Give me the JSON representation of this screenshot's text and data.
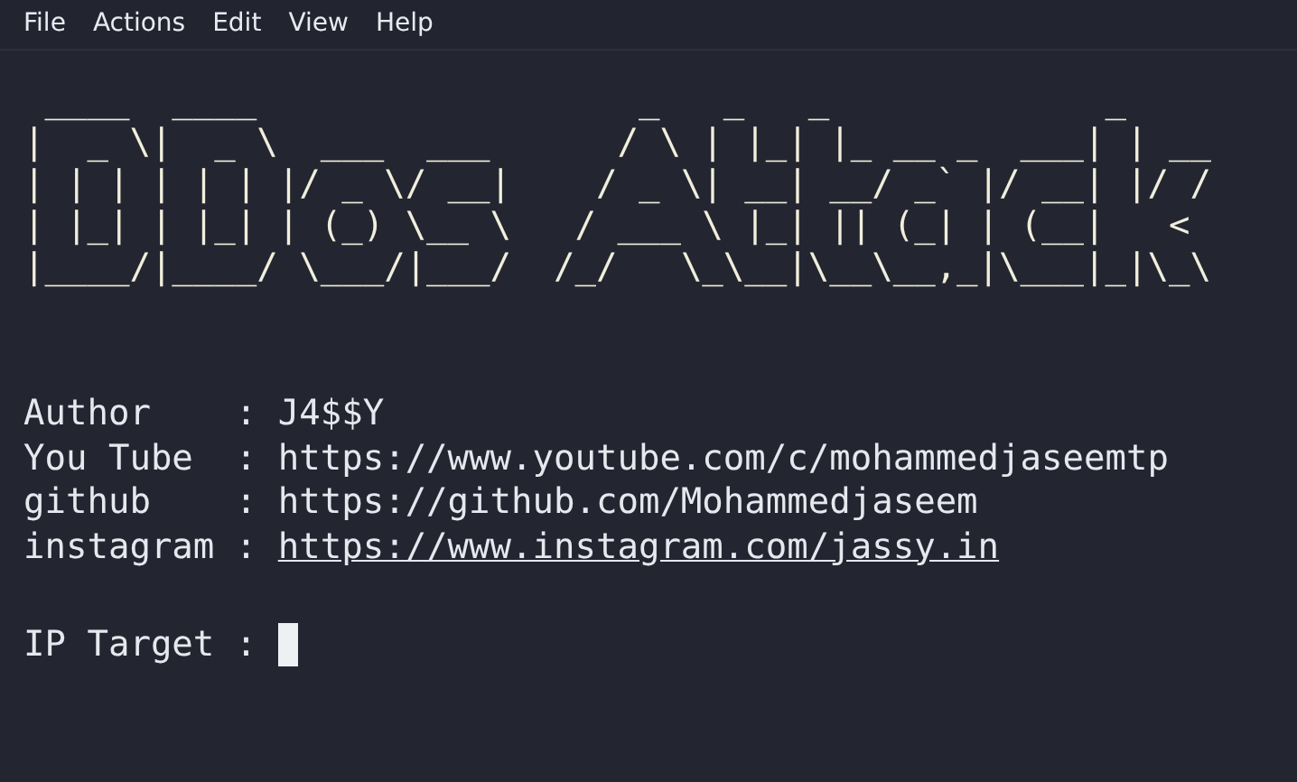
{
  "menu": [
    "File",
    "Actions",
    "Edit",
    "View",
    "Help"
  ],
  "terminal": {
    "banner_lines": [
      " ____  ____                  _   _   _             _",
      "|  _ \\|  _ \\  ___  ___      / \\ | |_| |_ __ _  ___| | __",
      "| | | | | | |/ _ \\/ __|    / _ \\| __| __/ _` |/ __| |/ /",
      "| |_| | |_| | (_) \\__ \\   / ___ \\ |_| || (_| | (__|   <",
      "|____/|____/ \\___/|___/  /_/   \\_\\__|\\__\\__,_|\\___|_|\\_\\"
    ],
    "info": [
      {
        "label": "Author",
        "separator": ":",
        "value": "J4$$Y",
        "underlined": false
      },
      {
        "label": "You Tube",
        "separator": ":",
        "value": "https://www.youtube.com/c/mohammedjaseemtp",
        "underlined": false
      },
      {
        "label": "github",
        "separator": ":",
        "value": "https://github.com/Mohammedjaseem",
        "underlined": false
      },
      {
        "label": "instagram",
        "separator": ":",
        "value": "https://www.instagram.com/jassy.in",
        "underlined": true
      }
    ],
    "prompt": "IP Target :"
  }
}
